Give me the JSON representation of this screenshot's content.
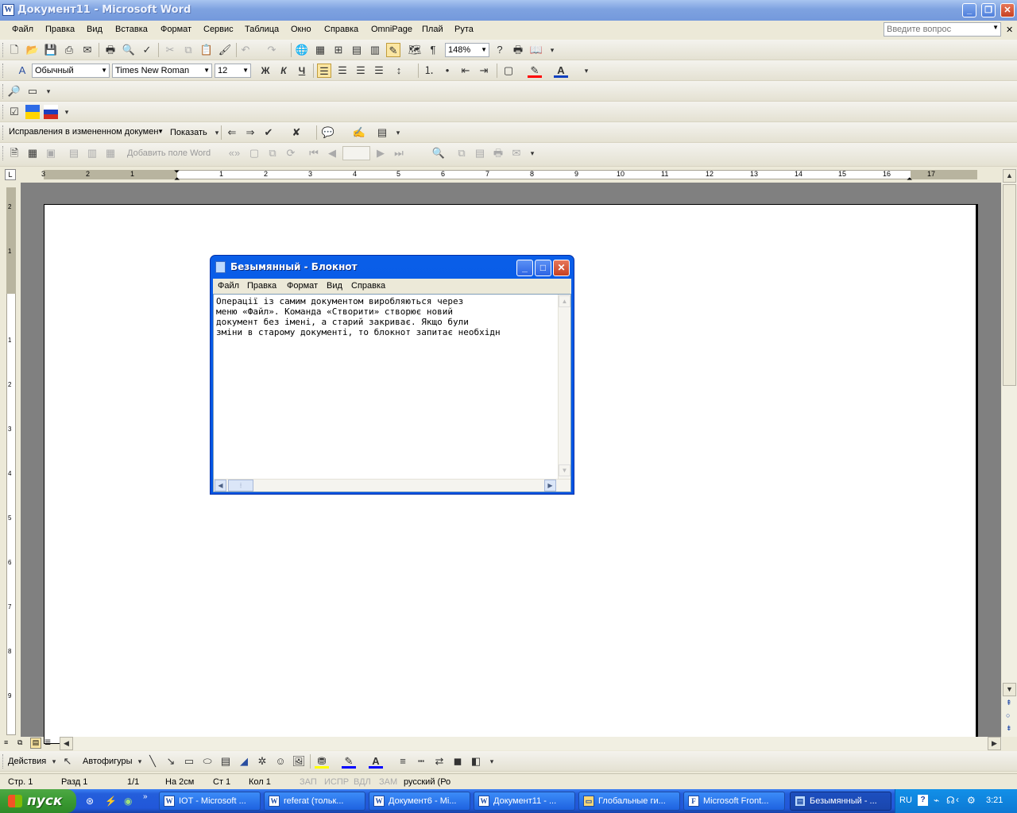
{
  "window": {
    "title": "Документ11 - Microsoft Word"
  },
  "menu": [
    "Файл",
    "Правка",
    "Вид",
    "Вставка",
    "Формат",
    "Сервис",
    "Таблица",
    "Окно",
    "Справка",
    "OmniPage",
    "Плай",
    "Рута"
  ],
  "ask_placeholder": "Введите вопрос",
  "zoom": "148%",
  "formatting": {
    "style": "Обычный",
    "font": "Times New Roman",
    "size": "12"
  },
  "bold_label": "Ж",
  "italic_label": "К",
  "underline_label": "Ч",
  "review": {
    "mode": "Исправления в измененном докумен",
    "show_label": "Показать"
  },
  "forms": {
    "add_field": "Добавить поле Word"
  },
  "ruler": {
    "labels": [
      "3",
      "2",
      "1",
      "1",
      "2",
      "3",
      "4",
      "5",
      "6",
      "7",
      "8",
      "9",
      "10",
      "11",
      "12",
      "13",
      "14",
      "15",
      "16",
      "17"
    ]
  },
  "vruler": {
    "labels": [
      "2",
      "1",
      "1",
      "2",
      "3",
      "4",
      "5",
      "6",
      "7",
      "8",
      "9"
    ]
  },
  "notepad": {
    "title": "Безымянный - Блокнот",
    "menu": [
      "Файл",
      "Правка",
      "Формат",
      "Вид",
      "Справка"
    ],
    "text": "Операції із самим документом виробляються через\nменю «Файл». Команда «Створити» створює новий\nдокумент без імені, а старий закриває. Якщо були\nзміни в старому документі, то блокнот запитає необхідн"
  },
  "drawing": {
    "actions": "Действия",
    "autoshapes": "Автофигуры"
  },
  "status": {
    "page": "Стр. 1",
    "section": "Разд 1",
    "pages": "1/1",
    "at": "На 2см",
    "line": "Ст 1",
    "col": "Кол 1",
    "rec": "ЗАП",
    "trk": "ИСПР",
    "ext": "ВДЛ",
    "ovr": "ЗАМ",
    "lang": "русский (Ро"
  },
  "taskbar": {
    "start": "пуск",
    "tasks": [
      "IOT - Microsoft ...",
      "referat (тольк...",
      "Документ6 - Mi...",
      "Документ11 - ...",
      "Глобальные ги...",
      "Microsoft Front...",
      "Безымянный - ..."
    ],
    "lang": "RU",
    "clock": "3:21"
  },
  "colors": {
    "titlebar": "#7499dc",
    "xp_blue": "#0054e3",
    "taskbar": "#245edb",
    "start": "#3a9a32"
  }
}
